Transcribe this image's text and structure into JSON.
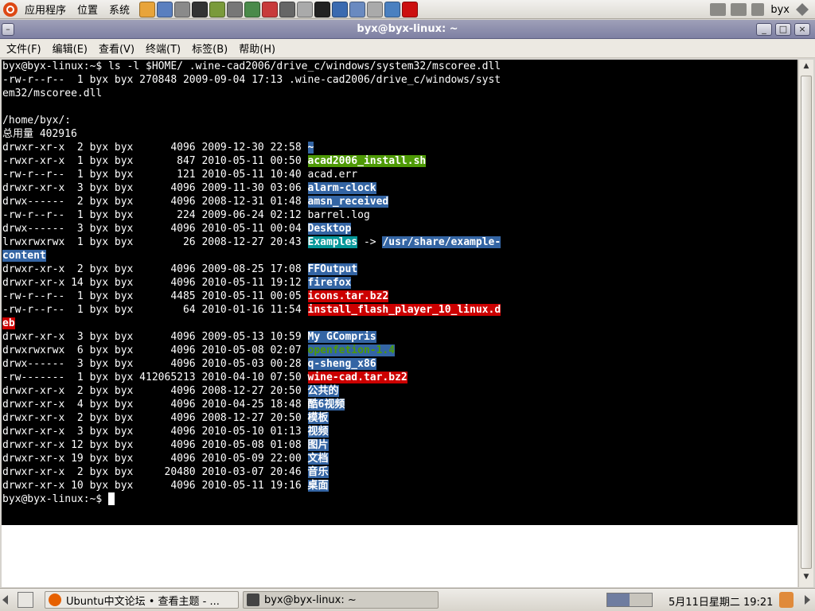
{
  "top_panel": {
    "menus": [
      "应用程序",
      "位置",
      "系统"
    ],
    "launchers": [
      "firefox-icon",
      "chart-icon",
      "settings-icon",
      "terminal-icon",
      "books-icon",
      "calculator-icon",
      "editor-icon",
      "paint-icon",
      "gimp-icon",
      "disk-icon",
      "tux-icon",
      "qq-icon",
      "contacts-icon",
      "mail-icon",
      "web-icon",
      "opera-icon"
    ],
    "user": "byx"
  },
  "window": {
    "title": "byx@byx-linux: ~",
    "menu": [
      "文件(F)",
      "编辑(E)",
      "查看(V)",
      "终端(T)",
      "标签(B)",
      "帮助(H)"
    ]
  },
  "terminal": {
    "lines": [
      [
        {
          "t": "byx@byx-linux:~$ ls -l $HOME/ .wine-cad2006/drive_c/windows/system32/mscoree.dll"
        }
      ],
      [
        {
          "t": "-rw-r--r--  1 byx byx 270848 2009-09-04 17:13 .wine-cad2006/drive_c/windows/syst"
        }
      ],
      [
        {
          "t": "em32/mscoree.dll"
        }
      ],
      [
        {
          "t": ""
        }
      ],
      [
        {
          "t": "/home/byx/:"
        }
      ],
      [
        {
          "t": "总用量 402916"
        }
      ],
      [
        {
          "t": "drwxr-xr-x  2 byx byx      4096 2009-12-30 22:58 "
        },
        {
          "t": "~",
          "c": "blue"
        }
      ],
      [
        {
          "t": "-rwxr-xr-x  1 byx byx       847 2010-05-11 00:50 "
        },
        {
          "t": "acad2006_install.sh",
          "c": "green"
        }
      ],
      [
        {
          "t": "-rw-r--r--  1 byx byx       121 2010-05-11 10:40 acad.err"
        }
      ],
      [
        {
          "t": "drwxr-xr-x  3 byx byx      4096 2009-11-30 03:06 "
        },
        {
          "t": "alarm-clock",
          "c": "blue"
        }
      ],
      [
        {
          "t": "drwx------  2 byx byx      4096 2008-12-31 01:48 "
        },
        {
          "t": "amsn_received",
          "c": "blue"
        }
      ],
      [
        {
          "t": "-rw-r--r--  1 byx byx       224 2009-06-24 02:12 barrel.log"
        }
      ],
      [
        {
          "t": "drwx------  3 byx byx      4096 2010-05-11 00:04 "
        },
        {
          "t": "Desktop",
          "c": "blue"
        }
      ],
      [
        {
          "t": "lrwxrwxrwx  1 byx byx        26 2008-12-27 20:43 "
        },
        {
          "t": "Examples",
          "c": "cyan"
        },
        {
          "t": " -> "
        },
        {
          "t": "/usr/share/example-",
          "c": "blue"
        }
      ],
      [
        {
          "t": "content",
          "c": "blue"
        }
      ],
      [
        {
          "t": "drwxr-xr-x  2 byx byx      4096 2009-08-25 17:08 "
        },
        {
          "t": "FFOutput",
          "c": "blue"
        }
      ],
      [
        {
          "t": "drwxr-xr-x 14 byx byx      4096 2010-05-11 19:12 "
        },
        {
          "t": "firefox",
          "c": "blue"
        }
      ],
      [
        {
          "t": "-rw-r--r--  1 byx byx      4485 2010-05-11 00:05 "
        },
        {
          "t": "icons.tar.bz2",
          "c": "red"
        }
      ],
      [
        {
          "t": "-rw-r--r--  1 byx byx        64 2010-01-16 11:54 "
        },
        {
          "t": "install_flash_player_10_linux.d",
          "c": "red"
        }
      ],
      [
        {
          "t": "eb",
          "c": "red"
        }
      ],
      [
        {
          "t": "drwxr-xr-x  3 byx byx      4096 2009-05-13 10:59 "
        },
        {
          "t": "My GCompris",
          "c": "blue"
        }
      ],
      [
        {
          "t": "drwxrwxrwx  6 byx byx      4096 2010-05-08 02:07 "
        },
        {
          "t": "openfetion-1.4",
          "c": "dimgreen"
        }
      ],
      [
        {
          "t": "drwx------  3 byx byx      4096 2010-05-03 00:28 "
        },
        {
          "t": "q-sheng_x86",
          "c": "blue"
        }
      ],
      [
        {
          "t": "-rw-------  1 byx byx 412065213 2010-04-10 07:50 "
        },
        {
          "t": "wine-cad.tar.bz2",
          "c": "red"
        }
      ],
      [
        {
          "t": "drwxr-xr-x  2 byx byx      4096 2008-12-27 20:50 "
        },
        {
          "t": "公共的",
          "c": "blue"
        }
      ],
      [
        {
          "t": "drwxr-xr-x  4 byx byx      4096 2010-04-25 18:48 "
        },
        {
          "t": "酷6视频",
          "c": "blue"
        }
      ],
      [
        {
          "t": "drwxr-xr-x  2 byx byx      4096 2008-12-27 20:50 "
        },
        {
          "t": "模板",
          "c": "blue"
        }
      ],
      [
        {
          "t": "drwxr-xr-x  3 byx byx      4096 2010-05-10 01:13 "
        },
        {
          "t": "视频",
          "c": "blue"
        }
      ],
      [
        {
          "t": "drwxr-xr-x 12 byx byx      4096 2010-05-08 01:08 "
        },
        {
          "t": "图片",
          "c": "blue"
        }
      ],
      [
        {
          "t": "drwxr-xr-x 19 byx byx      4096 2010-05-09 22:00 "
        },
        {
          "t": "文档",
          "c": "blue"
        }
      ],
      [
        {
          "t": "drwxr-xr-x  2 byx byx     20480 2010-03-07 20:46 "
        },
        {
          "t": "音乐",
          "c": "blue"
        }
      ],
      [
        {
          "t": "drwxr-xr-x 10 byx byx      4096 2010-05-11 19:16 "
        },
        {
          "t": "桌面",
          "c": "blue"
        }
      ],
      [
        {
          "t": "byx@byx-linux:~$ "
        },
        {
          "cursor": true
        }
      ]
    ]
  },
  "taskbar": {
    "tasks": [
      {
        "label": "Ubuntu中文论坛 • 查看主题 - ...",
        "icon": "firefox-icon"
      },
      {
        "label": "byx@byx-linux: ~",
        "icon": "terminal-icon"
      }
    ],
    "clock": "5月11日星期二  19:21"
  },
  "colors": {
    "terminal_bg": "#000000",
    "dir_highlight": "#3465a4",
    "exec_highlight": "#4e9a06",
    "archive_highlight": "#cc0000",
    "link_highlight": "#06989a"
  }
}
